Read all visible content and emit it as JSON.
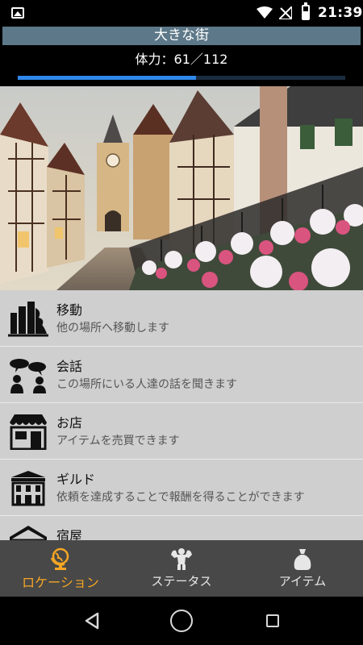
{
  "status_bar": {
    "time": "21:39"
  },
  "header": {
    "location_name": "大きな街",
    "hp_text": "体力：61／112",
    "hp_fraction": 0.545
  },
  "menu": {
    "items": [
      {
        "title": "移動",
        "description": "他の場所へ移動します",
        "icon": "move-icon"
      },
      {
        "title": "会話",
        "description": "この場所にいる人達の話を聞きます",
        "icon": "talk-icon"
      },
      {
        "title": "お店",
        "description": "アイテムを売買できます",
        "icon": "shop-icon"
      },
      {
        "title": "ギルド",
        "description": "依頼を達成することで報酬を得ることができます",
        "icon": "guild-icon"
      },
      {
        "title": "宿屋",
        "description": "",
        "icon": "inn-icon"
      }
    ]
  },
  "bottom_nav": {
    "tabs": [
      {
        "label": "ロケーション",
        "icon": "location-globe-icon",
        "active": true
      },
      {
        "label": "ステータス",
        "icon": "status-muscle-icon",
        "active": false
      },
      {
        "label": "アイテム",
        "icon": "item-bag-icon",
        "active": false
      }
    ],
    "active_color": "#f5a623"
  },
  "colors": {
    "title_bar": "#5d7888",
    "hp_fill": "#2f88ec",
    "menu_bg": "#cfcfcf",
    "nav_bg": "#484848"
  }
}
